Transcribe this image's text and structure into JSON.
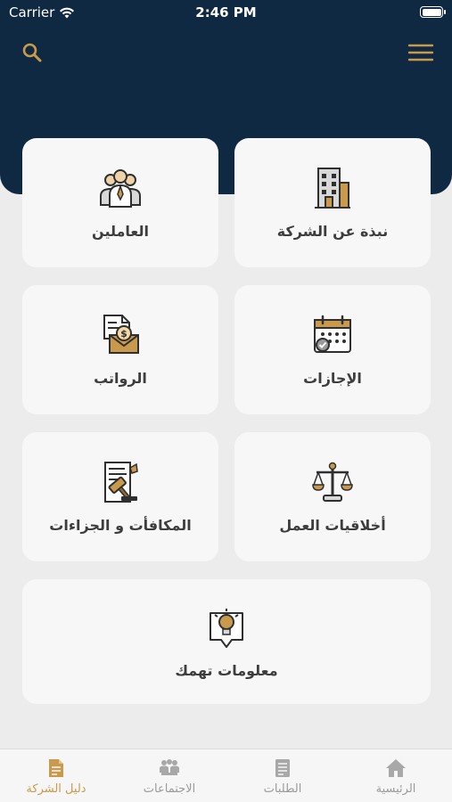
{
  "status_bar": {
    "carrier": "Carrier",
    "time": "2:46 PM"
  },
  "colors": {
    "header": "#0f2942",
    "accent": "#c99a4b",
    "card": "#f7f7f8",
    "background": "#ececec"
  },
  "header": {
    "left_icon": "search-icon",
    "right_icon": "hamburger-menu-icon"
  },
  "cards": [
    {
      "label": "نبذة عن الشركة",
      "icon": "building-icon"
    },
    {
      "label": "العاملين",
      "icon": "employees-group-icon"
    },
    {
      "label": "الإجازات",
      "icon": "calendar-check-icon"
    },
    {
      "label": "الرواتب",
      "icon": "salary-envelope-icon"
    },
    {
      "label": "أخلاقيات العمل",
      "icon": "justice-scale-icon"
    },
    {
      "label": "المكافأت و الجزاءات",
      "icon": "gavel-document-icon"
    },
    {
      "label": "معلومات تهمك",
      "icon": "lightbulb-icon"
    }
  ],
  "tabbar": [
    {
      "label": "دليل الشركة",
      "icon": "document-icon",
      "active": true
    },
    {
      "label": "الاجتماعات",
      "icon": "meeting-icon",
      "active": false
    },
    {
      "label": "الطلبات",
      "icon": "list-document-icon",
      "active": false
    },
    {
      "label": "الرئيسية",
      "icon": "home-icon",
      "active": false
    }
  ]
}
